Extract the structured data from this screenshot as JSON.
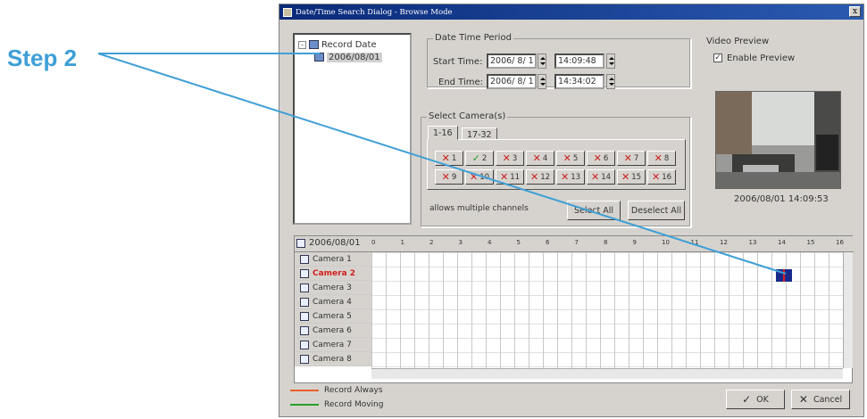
{
  "annotation": {
    "step_label": "Step 2"
  },
  "window": {
    "title": "Date/Time Search Dialog - Browse Mode",
    "close_label": "x"
  },
  "tree": {
    "root_label": "Record Date",
    "root_toggle": "-",
    "child_label": "2006/08/01"
  },
  "date_time_period": {
    "group_title": "Date Time Period",
    "start_label": "Start Time:",
    "start_date": "2006/ 8/ 1",
    "start_time": "14:09:48",
    "end_label": "End Time:",
    "end_date": "2006/ 8/ 1",
    "end_time": "14:34:02"
  },
  "cameras": {
    "group_title": "Select Camera(s)",
    "tabs": [
      "1-16",
      "17-32"
    ],
    "buttons": [
      {
        "label": "1",
        "checked": false
      },
      {
        "label": "2",
        "checked": true
      },
      {
        "label": "3",
        "checked": false
      },
      {
        "label": "4",
        "checked": false
      },
      {
        "label": "5",
        "checked": false
      },
      {
        "label": "6",
        "checked": false
      },
      {
        "label": "7",
        "checked": false
      },
      {
        "label": "8",
        "checked": false
      },
      {
        "label": "9",
        "checked": false
      },
      {
        "label": "10",
        "checked": false
      },
      {
        "label": "11",
        "checked": false
      },
      {
        "label": "12",
        "checked": false
      },
      {
        "label": "13",
        "checked": false
      },
      {
        "label": "14",
        "checked": false
      },
      {
        "label": "15",
        "checked": false
      },
      {
        "label": "16",
        "checked": false
      }
    ],
    "hint": "allows multiple channels",
    "select_all": "Select All",
    "deselect_all": "Deselect All"
  },
  "preview": {
    "group_title": "Video Preview",
    "enable_label": "Enable Preview",
    "enable_checked": true,
    "timestamp": "2006/08/01 14:09:53"
  },
  "timeline": {
    "date": "2006/08/01",
    "hours": [
      "0",
      "1",
      "2",
      "3",
      "4",
      "5",
      "6",
      "7",
      "8",
      "9",
      "10",
      "11",
      "12",
      "13",
      "14",
      "15",
      "16"
    ],
    "cameras": [
      "Camera 1",
      "Camera 2",
      "Camera 3",
      "Camera 4",
      "Camera 5",
      "Camera 6",
      "Camera 7",
      "Camera 8"
    ],
    "active_camera": "Camera 2"
  },
  "legend": {
    "always": "Record Always",
    "moving": "Record Moving",
    "always_color": "#e8602a",
    "moving_color": "#2aa02a"
  },
  "footer": {
    "ok": "OK",
    "cancel": "Cancel"
  }
}
